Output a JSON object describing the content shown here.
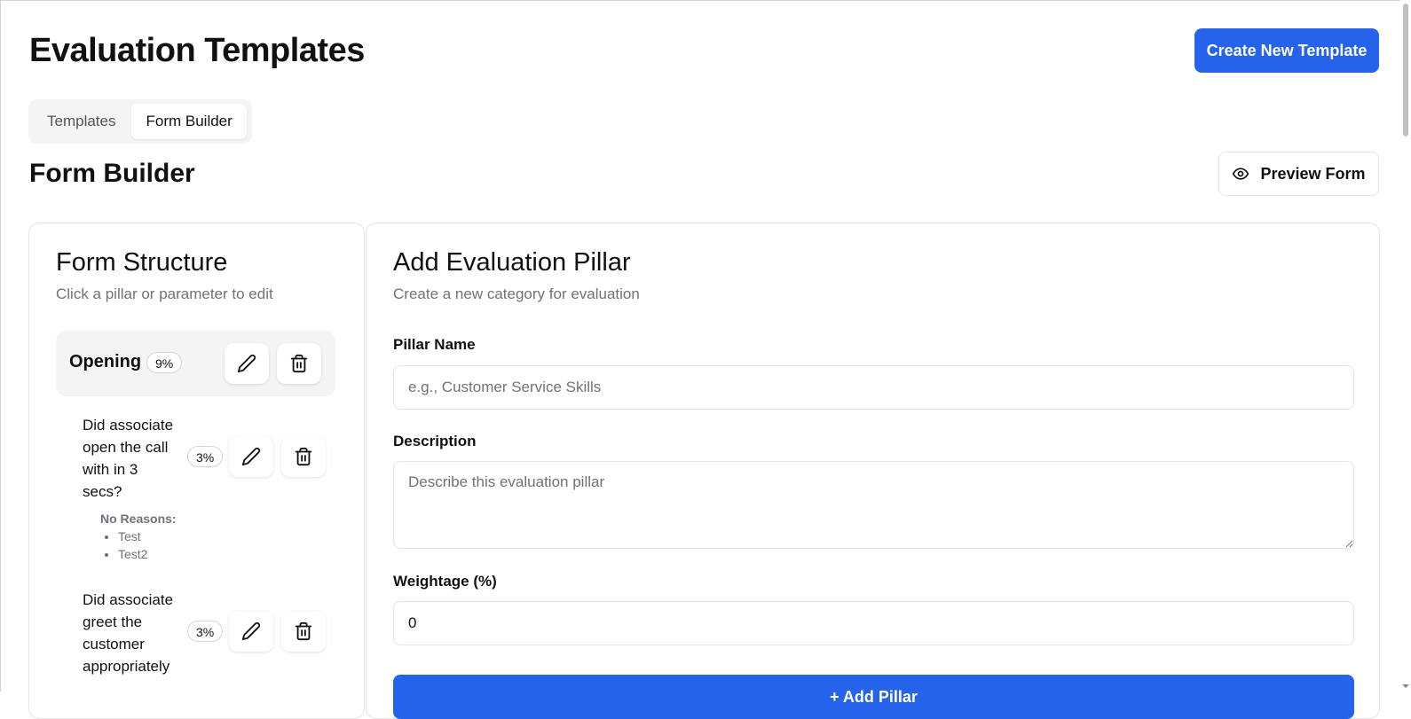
{
  "header": {
    "title": "Evaluation Templates",
    "create_button_label": "Create New Template"
  },
  "tabs": [
    {
      "label": "Templates",
      "active": false
    },
    {
      "label": "Form Builder",
      "active": true
    }
  ],
  "section": {
    "title": "Form Builder",
    "preview_button_label": "Preview Form",
    "preview_icon": "eye-icon"
  },
  "form_structure": {
    "title": "Form Structure",
    "subtitle": "Click a pillar or parameter to edit",
    "pillar": {
      "name": "Opening",
      "weight": "9%"
    },
    "parameters": [
      {
        "text": "Did associate open the call with in 3 secs?",
        "weight": "3%",
        "reasons_label": "No Reasons:",
        "reasons": [
          "Test",
          "Test2"
        ]
      },
      {
        "text": "Did associate greet the customer appropriately",
        "weight": "3%"
      }
    ],
    "edit_icon": "pencil-icon",
    "delete_icon": "trash-icon"
  },
  "add_pillar": {
    "title": "Add Evaluation Pillar",
    "subtitle": "Create a new category for evaluation",
    "name_label": "Pillar Name",
    "name_placeholder": "e.g., Customer Service Skills",
    "name_value": "",
    "description_label": "Description",
    "description_placeholder": "Describe this evaluation pillar",
    "description_value": "",
    "weight_label": "Weightage (%)",
    "weight_value": "0",
    "submit_label": "+ Add Pillar"
  },
  "colors": {
    "accent": "#2563eb",
    "muted_text": "#71717a",
    "border": "#e4e4e7",
    "pillar_bg": "#f4f4f5"
  }
}
